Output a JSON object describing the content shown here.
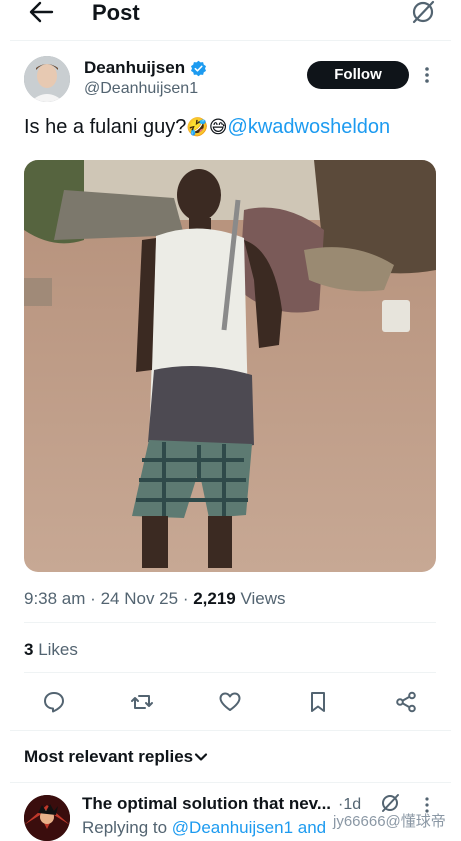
{
  "header": {
    "title": "Post"
  },
  "tweet": {
    "display_name": "Deanhuijsen",
    "handle": "@Deanhuijsen1",
    "follow_label": "Follow",
    "text": "Is he a fulani guy?",
    "emojis": "🤣😅",
    "mention": "@kwadwosheldon",
    "time": "9:38 am",
    "date": "24 Nov 25",
    "views_count": "2,219",
    "views_label": "Views",
    "likes_count": "3",
    "likes_label": "Likes",
    "sep": "·"
  },
  "replies": {
    "sort_label": "Most relevant replies",
    "first": {
      "name": "The optimal solution that nev...",
      "age": "1d",
      "replying_prefix": "Replying to",
      "replying_to": "@Deanhuijsen1 and",
      "watermark": "jy66666@懂球帝"
    }
  },
  "colors": {
    "accent": "#1d9bf0",
    "text": "#0f1419",
    "muted": "#536471",
    "verified": "#1d9bf0"
  }
}
